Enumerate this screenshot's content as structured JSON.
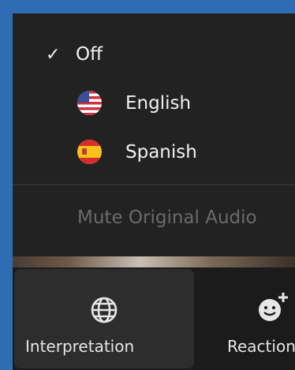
{
  "menu": {
    "off_label": "Off",
    "off_checked": true,
    "languages": [
      {
        "label": "English",
        "flag": "us-flag-icon"
      },
      {
        "label": "Spanish",
        "flag": "spain-flag-icon"
      }
    ],
    "mute_label": "Mute Original Audio"
  },
  "toolbar": {
    "interpretation_label": "Interpretation",
    "reactions_label": "Reactions"
  },
  "colors": {
    "background": "#2e6db3",
    "menu_bg": "#222222",
    "text": "#f1f1f1",
    "disabled_text": "#6a6a6a"
  }
}
